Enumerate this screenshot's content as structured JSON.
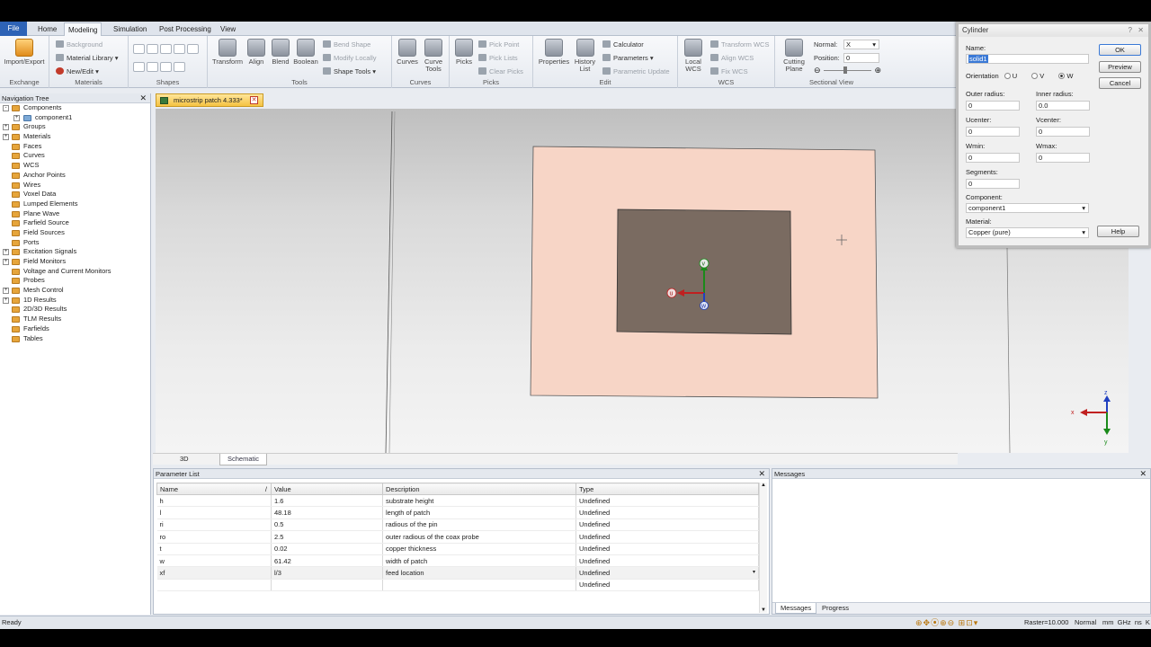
{
  "menu_tabs": [
    "File",
    "Home",
    "Modeling",
    "Simulation",
    "Post Processing",
    "View"
  ],
  "ribbon": {
    "exchange": {
      "import_export": "Import/Export",
      "label": "Exchange"
    },
    "materials": {
      "background": "Background",
      "material_library": "Material Library",
      "new_edit": "New/Edit",
      "label": "Materials"
    },
    "shapes": {
      "label": "Shapes"
    },
    "tools": {
      "transform": "Transform",
      "align": "Align",
      "blend": "Blend",
      "boolean": "Boolean",
      "bend_shape": "Bend Shape",
      "modify_locally": "Modify Locally",
      "shape_tools": "Shape Tools",
      "label": "Tools"
    },
    "curves": {
      "curves": "Curves",
      "curve_tools": "Curve Tools",
      "label": "Curves"
    },
    "picks": {
      "picks": "Picks",
      "pick_point": "Pick Point",
      "pick_lists": "Pick Lists",
      "clear_picks": "Clear Picks",
      "label": "Picks"
    },
    "edit": {
      "properties": "Properties",
      "history_list": "History List",
      "calculator": "Calculator",
      "parameters": "Parameters",
      "parametric_update": "Parametric Update",
      "label": "Edit"
    },
    "wcs": {
      "local_wcs": "Local WCS",
      "transform_wcs": "Transform WCS",
      "align_wcs": "Align WCS",
      "fix_wcs": "Fix WCS",
      "label": "WCS"
    },
    "sectional_view": {
      "cutting_plane": "Cutting Plane",
      "normal_label": "Normal:",
      "normal_value": "X",
      "position_label": "Position:",
      "position_value": "0",
      "label": "Sectional View"
    }
  },
  "nav_tree": {
    "title": "Navigation Tree",
    "items": [
      {
        "label": "Components",
        "expand": "-"
      },
      {
        "label": "component1",
        "expand": "+",
        "child": true
      },
      {
        "label": "Groups",
        "expand": "+"
      },
      {
        "label": "Materials",
        "expand": "+"
      },
      {
        "label": "Faces",
        "expand": ""
      },
      {
        "label": "Curves",
        "expand": ""
      },
      {
        "label": "WCS",
        "expand": ""
      },
      {
        "label": "Anchor Points",
        "expand": ""
      },
      {
        "label": "Wires",
        "expand": ""
      },
      {
        "label": "Voxel Data",
        "expand": ""
      },
      {
        "label": "Lumped Elements",
        "expand": ""
      },
      {
        "label": "Plane Wave",
        "expand": ""
      },
      {
        "label": "Farfield Source",
        "expand": ""
      },
      {
        "label": "Field Sources",
        "expand": ""
      },
      {
        "label": "Ports",
        "expand": ""
      },
      {
        "label": "Excitation Signals",
        "expand": "+"
      },
      {
        "label": "Field Monitors",
        "expand": "+"
      },
      {
        "label": "Voltage and Current Monitors",
        "expand": ""
      },
      {
        "label": "Probes",
        "expand": ""
      },
      {
        "label": "Mesh Control",
        "expand": "+"
      },
      {
        "label": "1D Results",
        "expand": "+"
      },
      {
        "label": "2D/3D Results",
        "expand": ""
      },
      {
        "label": "TLM Results",
        "expand": ""
      },
      {
        "label": "Farfields",
        "expand": ""
      },
      {
        "label": "Tables",
        "expand": ""
      }
    ]
  },
  "document_tab": "microstrip patch 4.333*",
  "viewport": {
    "axis_u": "u",
    "axis_v": "v",
    "axis_w": "w",
    "axis_x": "x",
    "axis_y": "y",
    "axis_z": "z"
  },
  "view_tabs": [
    "3D",
    "Schematic"
  ],
  "param_list": {
    "title": "Parameter List",
    "columns": [
      "Name",
      "Value",
      "Description",
      "Type"
    ],
    "rows": [
      {
        "name": "h",
        "value": "1.6",
        "desc": "substrate height",
        "type": "Undefined"
      },
      {
        "name": "l",
        "value": "48.18",
        "desc": "length of patch",
        "type": "Undefined"
      },
      {
        "name": "ri",
        "value": "0.5",
        "desc": "radious of the pin",
        "type": "Undefined"
      },
      {
        "name": "ro",
        "value": "2.5",
        "desc": "outer radious of the coax probe",
        "type": "Undefined"
      },
      {
        "name": "t",
        "value": "0.02",
        "desc": "copper thickness",
        "type": "Undefined"
      },
      {
        "name": "w",
        "value": "61.42",
        "desc": "width of patch",
        "type": "Undefined"
      },
      {
        "name": "xf",
        "value": "l/3",
        "desc": "feed location",
        "type": "Undefined"
      },
      {
        "name": "",
        "value": "",
        "desc": "",
        "type": "Undefined"
      }
    ]
  },
  "messages": {
    "title": "Messages",
    "tabs": [
      "Messages",
      "Progress"
    ]
  },
  "status": {
    "left": "Ready",
    "raster": "Raster=10.000",
    "mode": "Normal",
    "units": "mm  GHz  ns  K"
  },
  "dialog": {
    "title": "Cylinder",
    "name_label": "Name:",
    "name_value": "solid1",
    "orientation_label": "Orientation",
    "orient_u": "U",
    "orient_v": "V",
    "orient_w": "W",
    "outer_radius_label": "Outer radius:",
    "outer_radius": "0",
    "inner_radius_label": "Inner radius:",
    "inner_radius": "0.0",
    "ucenter_label": "Ucenter:",
    "ucenter": "0",
    "vcenter_label": "Vcenter:",
    "vcenter": "0",
    "wmin_label": "Wmin:",
    "wmin": "0",
    "wmax_label": "Wmax:",
    "wmax": "0",
    "segments_label": "Segments:",
    "segments": "0",
    "component_label": "Component:",
    "component": "component1",
    "material_label": "Material:",
    "material": "Copper (pure)",
    "ok": "OK",
    "preview": "Preview",
    "cancel": "Cancel",
    "help": "Help"
  }
}
